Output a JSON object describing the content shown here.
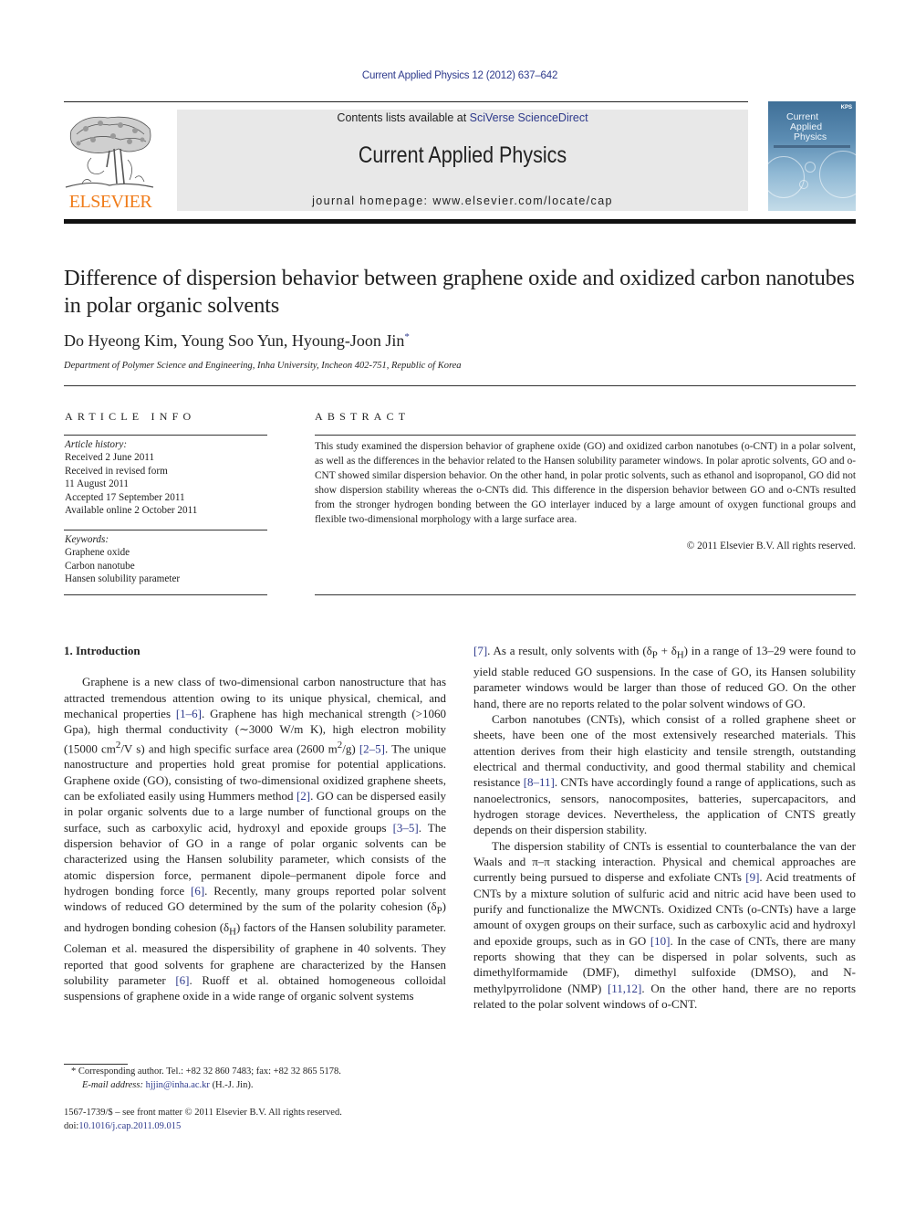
{
  "header": {
    "citation": "Current Applied Physics 12 (2012) 637–642",
    "contents_prefix": "Contents lists available at ",
    "contents_link": "SciVerse ScienceDirect",
    "journal_name": "Current Applied Physics",
    "homepage_prefix": "journal homepage: ",
    "homepage_url": "www.elsevier.com/locate/cap",
    "publisher_logo_text": "ELSEVIER",
    "cover": {
      "title_lines": [
        "Current",
        "Applied",
        "Physics"
      ],
      "badge": "KPS"
    }
  },
  "article": {
    "title": "Difference of dispersion behavior between graphene oxide and oxidized carbon nanotubes in polar organic solvents",
    "authors": "Do Hyeong Kim, Young Soo Yun, Hyoung-Joon Jin",
    "corresponding_mark": "*",
    "affiliation": "Department of Polymer Science and Engineering, Inha University, Incheon 402-751, Republic of Korea"
  },
  "article_info": {
    "heading": "ARTICLE INFO",
    "history_label": "Article history:",
    "history": [
      "Received 2 June 2011",
      "Received in revised form",
      "11 August 2011",
      "Accepted 17 September 2011",
      "Available online 2 October 2011"
    ],
    "keywords_label": "Keywords:",
    "keywords": [
      "Graphene oxide",
      "Carbon nanotube",
      "Hansen solubility parameter"
    ]
  },
  "abstract": {
    "heading": "ABSTRACT",
    "text": "This study examined the dispersion behavior of graphene oxide (GO) and oxidized carbon nanotubes (o-CNT) in a polar solvent, as well as the differences in the behavior related to the Hansen solubility parameter windows. In polar aprotic solvents, GO and o-CNT showed similar dispersion behavior. On the other hand, in polar protic solvents, such as ethanol and isopropanol, GO did not show dispersion stability whereas the o-CNTs did. This difference in the dispersion behavior between GO and o-CNTs resulted from the stronger hydrogen bonding between the GO interlayer induced by a large amount of oxygen functional groups and flexible two-dimensional morphology with a large surface area.",
    "copyright": "© 2011 Elsevier B.V. All rights reserved."
  },
  "body": {
    "section_heading": "1.  Introduction",
    "p1": {
      "t1": "Graphene is a new class of two-dimensional carbon nano­structure that has attracted tremendous attention owing to its unique physical, chemical, and mechanical properties ",
      "r1": "[1–6]",
      "t2": ". Gra­phene has high mechanical strength (>1060 Gpa), high thermal conductivity (∼3000 W/m K), high electron mobility (15000 cm",
      "sup1": "2",
      "t3": "/V s) and high specific surface area (2600 m",
      "sup2": "2",
      "t4": "/g) ",
      "r2": "[2–5]",
      "t5": ". The unique nanostructure and properties hold great promise for potential applications. Graphene oxide (GO), consisting of two-dimensional oxidized graphene sheets, can be exfoliated easily using Hummers method ",
      "r3": "[2]",
      "t6": ". GO can be dispersed easily in polar organic solvents due to a large number of functional groups on the surface, such as carboxylic acid, hydroxyl and epoxide groups ",
      "r4": "[3–5]",
      "t7": ". The dispersion behavior of GO in a range of polar organic solvents can be characterized using the Hansen solubility parameter, which consists of the atomic dispersion force, permanent dipo­le–permanent dipole force and hydrogen bonding force ",
      "r5": "[6]",
      "t8": ". Recently, many groups reported polar solvent windows of reduced GO determined by the sum of the polarity cohesion (δ",
      "sub1": "P",
      "t9": ") and hydrogen bonding cohesion (δ",
      "sub2": "H",
      "t10": ") factors of the Hansen solubility parameter. Coleman et al. measured the dispersibility of graphene in 40 solvents. They reported that good solvents for graphene are characterized by the Hansen solubility parameter ",
      "r6": "[6]",
      "t11": ". Ruoff et al. obtained homogeneous colloidal suspensions of graphene oxide in a wide range of organic solvent systems ",
      "r7": "[7]",
      "t12": ". As a result, only solvents with (δ",
      "sub3": "P",
      "t13": " + δ",
      "sub4": "H",
      "t14": ") in a range of 13–29 were found to yield stable reduced GO suspensions. In the case of GO, its Hansen solubility parameter windows would be larger than those of reduced GO. On the other hand, there are no reports related to the polar solvent windows of GO."
    },
    "p2": {
      "t1": "Carbon nanotubes (CNTs), which consist of a rolled graphene sheet or sheets, have been one of the most extensively researched materials. This attention derives from their high elasticity and tensile strength, outstanding electrical and thermal conductivity, and good thermal stability and chemical resistance ",
      "r1": "[8–11]",
      "t2": ". CNTs have accordingly found a range of applications, such as nano­electronics, sensors, nanocomposites, batteries, supercapacitors, and hydrogen storage devices. Nevertheless, the application of CNTS greatly depends on their dispersion stability."
    },
    "p3": {
      "t1": "The dispersion stability of CNTs is essential to counterbalance the van der Waals and π–π stacking interaction. Physical and chemical approaches are currently being pursued to disperse and exfoliate CNTs ",
      "r1": "[9]",
      "t2": ". Acid treatments of CNTs by a mixture solution of sulfuric acid and nitric acid have been used to purify and func­tionalize the MWCNTs. Oxidized CNTs (o-CNTs) have a large amount of oxygen groups on their surface, such as carboxylic acid and hydroxyl and epoxide groups, such as in GO ",
      "r2": "[10]",
      "t3": ". In the case of CNTs, there are many reports showing that they can be dispersed in polar solvents, such as dimethylformamide (DMF), dimethyl sulf­oxide (DMSO), and N-methylpyrrolidone (NMP) ",
      "r3": "[11,12]",
      "t4": ". On the other hand, there are no reports related to the polar solvent windows of o-CNT."
    }
  },
  "footnote": {
    "mark": "*",
    "text": " Corresponding author. Tel.: +82 32 860 7483; fax: +82 32 865 5178.",
    "email_label": "E-mail address:",
    "email": "hjjin@inha.ac.kr",
    "email_suffix": " (H.-J. Jin)."
  },
  "front_matter": {
    "issn_line": "1567-1739/$ – see front matter © 2011 Elsevier B.V. All rights reserved.",
    "doi_prefix": "doi:",
    "doi": "10.1016/j.cap.2011.09.015"
  },
  "colors": {
    "link": "#2e3a8c",
    "elsevier_orange": "#f07c1a",
    "banner_bg": "#e8e8e8"
  }
}
